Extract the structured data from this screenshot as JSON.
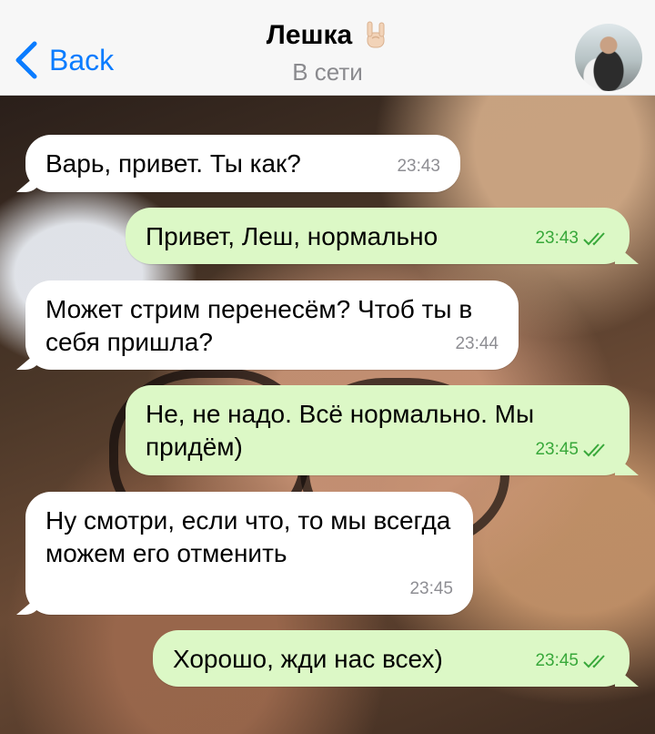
{
  "header": {
    "back_label": "Back",
    "contact_name": "Лешка",
    "status": "В сети"
  },
  "icons": {
    "back": "chevron-left-icon",
    "emoji": "rock-hand-icon",
    "read_receipt": "double-check-icon",
    "avatar": "avatar-photo"
  },
  "colors": {
    "accent": "#0a7cff",
    "incoming_bubble": "#ffffff",
    "outgoing_bubble": "#dcf8c6",
    "outgoing_time": "#38a83a"
  },
  "messages": [
    {
      "direction": "in",
      "text": "Варь, привет. Ты как?",
      "time": "23:43"
    },
    {
      "direction": "out",
      "text": "Привет, Леш, нормально",
      "time": "23:43",
      "read": true
    },
    {
      "direction": "in",
      "text": "Может стрим перенесём? Чтоб ты в себя пришла?",
      "time": "23:44"
    },
    {
      "direction": "out",
      "text": "Не, не надо. Всё нормально. Мы придём)",
      "time": "23:45",
      "read": true
    },
    {
      "direction": "in",
      "text": "Ну смотри, если что, то мы всегда можем его отменить",
      "time": "23:45"
    },
    {
      "direction": "out",
      "text": "Хорошо, жди нас всех)",
      "time": "23:45",
      "read": true
    }
  ]
}
